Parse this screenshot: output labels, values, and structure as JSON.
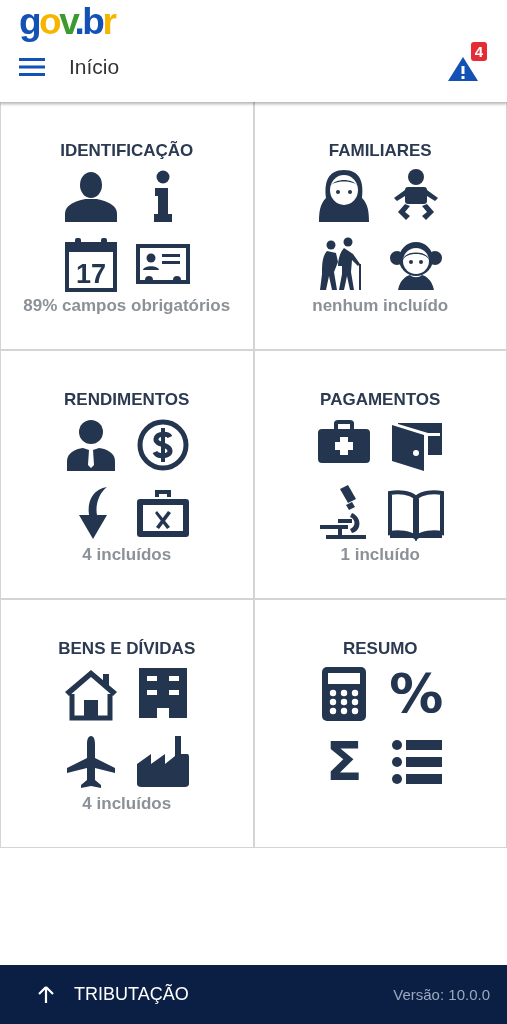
{
  "logo": "gov.br",
  "header": {
    "title": "Início",
    "alert_count": "4"
  },
  "tiles": [
    {
      "title": "IDENTIFICAÇÃO",
      "icons": [
        {
          "kind": "person"
        },
        {
          "kind": "info"
        },
        {
          "kind": "calendar",
          "text": "17"
        },
        {
          "kind": "id-card"
        }
      ],
      "caption": "89% campos obrigatórios"
    },
    {
      "title": "FAMILIARES",
      "icons": [
        {
          "kind": "woman"
        },
        {
          "kind": "baby"
        },
        {
          "kind": "elderly"
        },
        {
          "kind": "girl"
        }
      ],
      "caption": "nenhum incluído"
    },
    {
      "title": "RENDIMENTOS",
      "icons": [
        {
          "kind": "businessman"
        },
        {
          "kind": "coin"
        },
        {
          "kind": "curved-arrow"
        },
        {
          "kind": "toolbox"
        }
      ],
      "caption": "4 incluídos"
    },
    {
      "title": "PAGAMENTOS",
      "icons": [
        {
          "kind": "medical-bag"
        },
        {
          "kind": "wallet"
        },
        {
          "kind": "microscope"
        },
        {
          "kind": "book"
        }
      ],
      "caption": "1 incluído"
    },
    {
      "title": "BENS E DÍVIDAS",
      "icons": [
        {
          "kind": "house"
        },
        {
          "kind": "building"
        },
        {
          "kind": "airplane"
        },
        {
          "kind": "factory"
        }
      ],
      "caption": "4 incluídos"
    },
    {
      "title": "RESUMO",
      "icons": [
        {
          "kind": "calculator"
        },
        {
          "kind": "glyph",
          "text": "%"
        },
        {
          "kind": "glyph",
          "text": "Σ"
        },
        {
          "kind": "list"
        }
      ]
    }
  ],
  "footer": {
    "button": "TRIBUTAÇÃO",
    "version": "Versão: 10.0.0"
  }
}
